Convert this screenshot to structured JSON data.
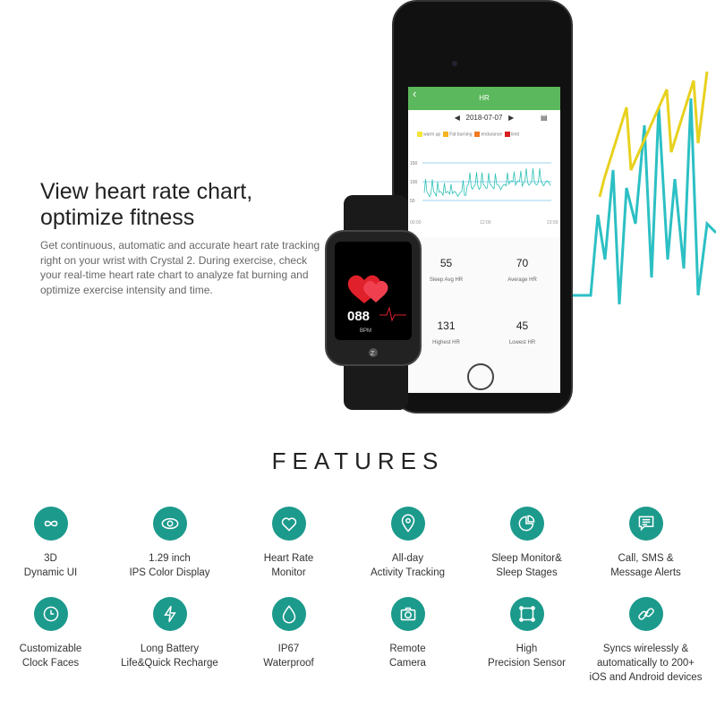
{
  "headline": {
    "line1": "View heart rate chart,",
    "line2": "optimize fitness"
  },
  "description": "Get continuous, automatic and accurate heart rate tracking right on your wrist with Crystal 2. During exercise, check your real-time heart rate chart to analyze fat burning and optimize exercise intensity and time.",
  "app": {
    "title": "HR",
    "date": "2018-07-07",
    "legend": [
      {
        "label": "warm up",
        "color": "#f5e43a"
      },
      {
        "label": "Fat burning",
        "color": "#f5b41e"
      },
      {
        "label": "endurance",
        "color": "#f07a22"
      },
      {
        "label": "limit",
        "color": "#d8201e"
      }
    ],
    "y_ticks": [
      "150",
      "100",
      "50"
    ],
    "x_ticks": [
      "00:00",
      "12:00",
      "23:59"
    ],
    "stats": [
      {
        "value": "55",
        "label": "Sleep Avg HR"
      },
      {
        "value": "70",
        "label": "Average HR"
      },
      {
        "value": "131",
        "label": "Highest HR"
      },
      {
        "value": "45",
        "label": "Lowest HR"
      }
    ]
  },
  "watch": {
    "bpm": "088",
    "bpm_label": "BPM",
    "logo": "Z"
  },
  "features_title": "FEATURES",
  "accent": "#1c9a8c",
  "features": [
    {
      "label": "3D\nDynamic UI",
      "icon": "infinity-icon"
    },
    {
      "label": "1.29 inch\nIPS Color Display",
      "icon": "eye-icon"
    },
    {
      "label": "Heart Rate\nMonitor",
      "icon": "heart-icon"
    },
    {
      "label": "All-day\nActivity Tracking",
      "icon": "location-pin-icon"
    },
    {
      "label": "Sleep Monitor&\nSleep Stages",
      "icon": "pie-chart-icon"
    },
    {
      "label": "Call,  SMS &\nMessage Alerts",
      "icon": "message-icon"
    },
    {
      "label": "Customizable\nClock Faces",
      "icon": "clock-icon"
    },
    {
      "label": "Long Battery\nLife&Quick Recharge",
      "icon": "lightning-icon"
    },
    {
      "label": "IP67\nWaterproof",
      "icon": "water-drop-icon"
    },
    {
      "label": "Remote\nCamera",
      "icon": "camera-icon"
    },
    {
      "label": "High\nPrecision Sensor",
      "icon": "sensor-square-icon"
    },
    {
      "label": "Syncs wirelessly &\nautomatically to 200+\niOS and Android devices",
      "icon": "link-icon"
    }
  ]
}
